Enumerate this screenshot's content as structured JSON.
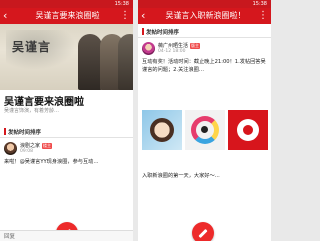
{
  "left": {
    "status_time": "15:38",
    "nav_title": "吴谨言要来浪圈啦",
    "cover_title": "吴谨言",
    "big_title": "吴谨言要来浪圈啦",
    "subtext": "吴谨言饰演，有着芳龄…",
    "section": "发帖时间排序",
    "post": {
      "user": "浪剧之家",
      "badge": "楼主",
      "time": "09:08",
      "text": "来啦！@吴谨言YY现身浪圈，参与互动…"
    },
    "reply_label": "回复"
  },
  "right": {
    "status_time": "15:38",
    "nav_title": "吴谨言入职新浪圈啦！",
    "section": "发帖时间排序",
    "post1": {
      "user": "薇广州晒生活",
      "badge": "版主",
      "time": "04-12 18:00",
      "text": "互动有奖！活动时间：截止晚上21:00！1.发帖回答吴谨言的问题；2.关注浪圈…"
    },
    "post2": {
      "text": "入职新浪圈的第一天，大家好～…"
    }
  },
  "colors": {
    "brand_red": "#d5171d",
    "fab_red": "#ed2a2a"
  },
  "icons": {
    "back": "back-arrow-icon",
    "more": "more-icon",
    "compose": "compose-pen-icon"
  }
}
